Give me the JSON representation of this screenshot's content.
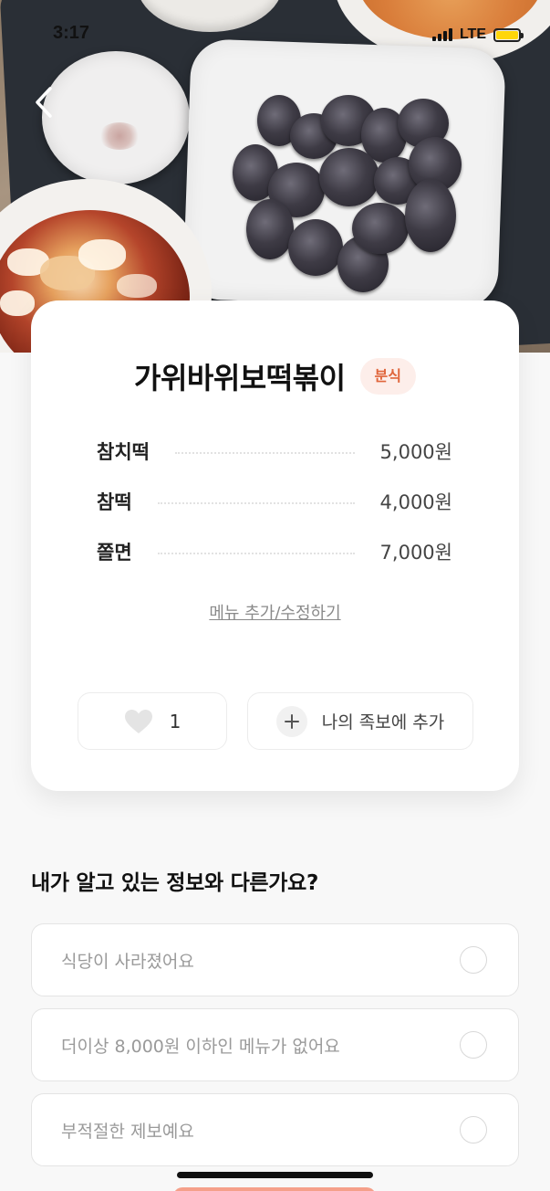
{
  "status_bar": {
    "time": "3:17",
    "network": "LTE",
    "battery_level": 1.0,
    "battery_color": "#ffd60a"
  },
  "nav": {
    "back_icon": "chevron-left-icon"
  },
  "store": {
    "name": "가위바위보떡볶이",
    "category": "분식",
    "category_color": "#e0663c"
  },
  "menu": {
    "items": [
      {
        "name": "참치떡",
        "price": "5,000원"
      },
      {
        "name": "참떡",
        "price": "4,000원"
      },
      {
        "name": "쫄면",
        "price": "7,000원"
      }
    ],
    "edit_link": "메뉴 추가/수정하기"
  },
  "actions": {
    "like_icon": "heart-icon",
    "like_count": "1",
    "add_icon": "plus-icon",
    "add_label": "나의 족보에 추가"
  },
  "report": {
    "title": "내가 알고 있는 정보와 다른가요?",
    "options": [
      {
        "label": "식당이 사라졌어요",
        "selected": false
      },
      {
        "label": "더이상 8,000원 이하인 메뉴가 없어요",
        "selected": false
      },
      {
        "label": "부적절한 제보예요",
        "selected": false
      }
    ]
  }
}
